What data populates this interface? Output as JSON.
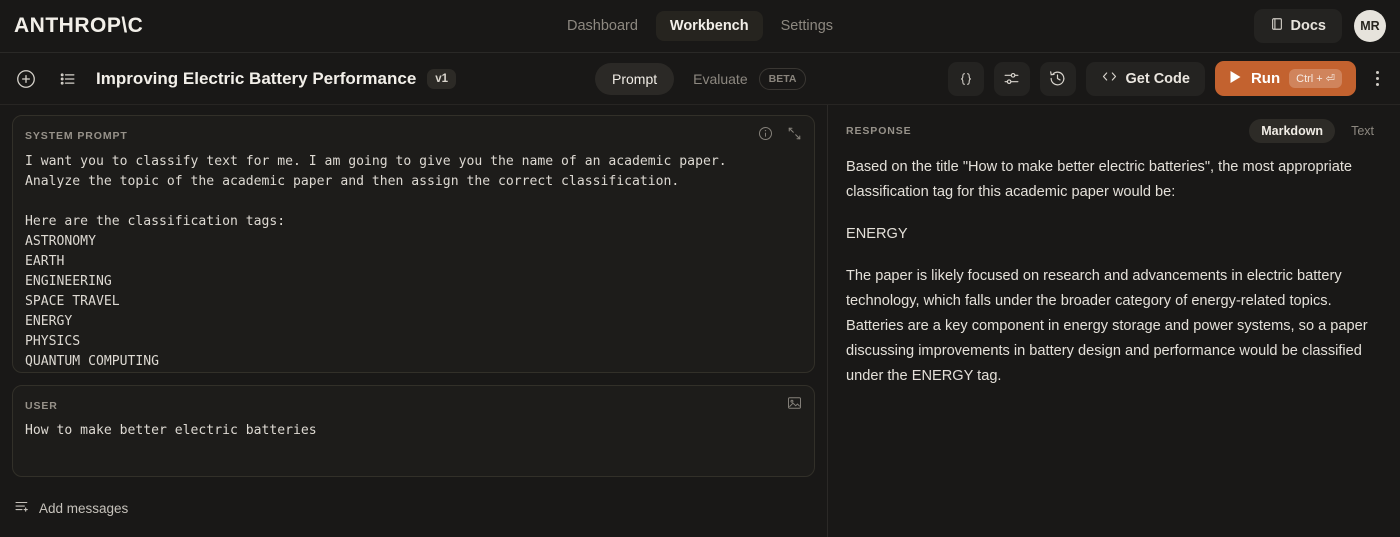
{
  "brand": "ANTHROP\\C",
  "nav": {
    "items": [
      {
        "label": "Dashboard",
        "active": false
      },
      {
        "label": "Workbench",
        "active": true
      },
      {
        "label": "Settings",
        "active": false
      }
    ],
    "docs_label": "Docs",
    "avatar_initials": "MR"
  },
  "toolbar": {
    "title": "Improving Electric Battery Performance",
    "version_badge": "v1",
    "tabs": [
      {
        "label": "Prompt",
        "active": true
      },
      {
        "label": "Evaluate",
        "active": false
      }
    ],
    "beta_badge": "BETA",
    "get_code_label": "Get Code",
    "run_label": "Run",
    "run_shortcut": "Ctrl + ⏎"
  },
  "system_prompt": {
    "label": "SYSTEM PROMPT",
    "text": "I want you to classify text for me. I am going to give you the name of an academic paper.\nAnalyze the topic of the academic paper and then assign the correct classification.\n\nHere are the classification tags:\nASTRONOMY\nEARTH\nENGINEERING\nSPACE TRAVEL\nENERGY\nPHYSICS\nQUANTUM COMPUTING"
  },
  "user_message": {
    "label": "USER",
    "text": "How to make better electric batteries"
  },
  "add_messages_label": "Add messages",
  "response": {
    "label": "RESPONSE",
    "view_modes": [
      {
        "label": "Markdown",
        "active": true
      },
      {
        "label": "Text",
        "active": false
      }
    ],
    "paragraphs": [
      "Based on the title \"How to make better electric batteries\", the most appropriate classification tag for this academic paper would be:",
      "ENERGY",
      "The paper is likely focused on research and advancements in electric battery technology, which falls under the broader category of energy-related topics. Batteries are a key component in energy storage and power systems, so a paper discussing improvements in battery design and performance would be classified under the ENERGY tag."
    ]
  },
  "colors": {
    "background": "#191817",
    "panel": "#1d1c1a",
    "accent_run": "#c3622f",
    "text_primary": "#f2efe9",
    "text_muted": "#8d8880"
  }
}
